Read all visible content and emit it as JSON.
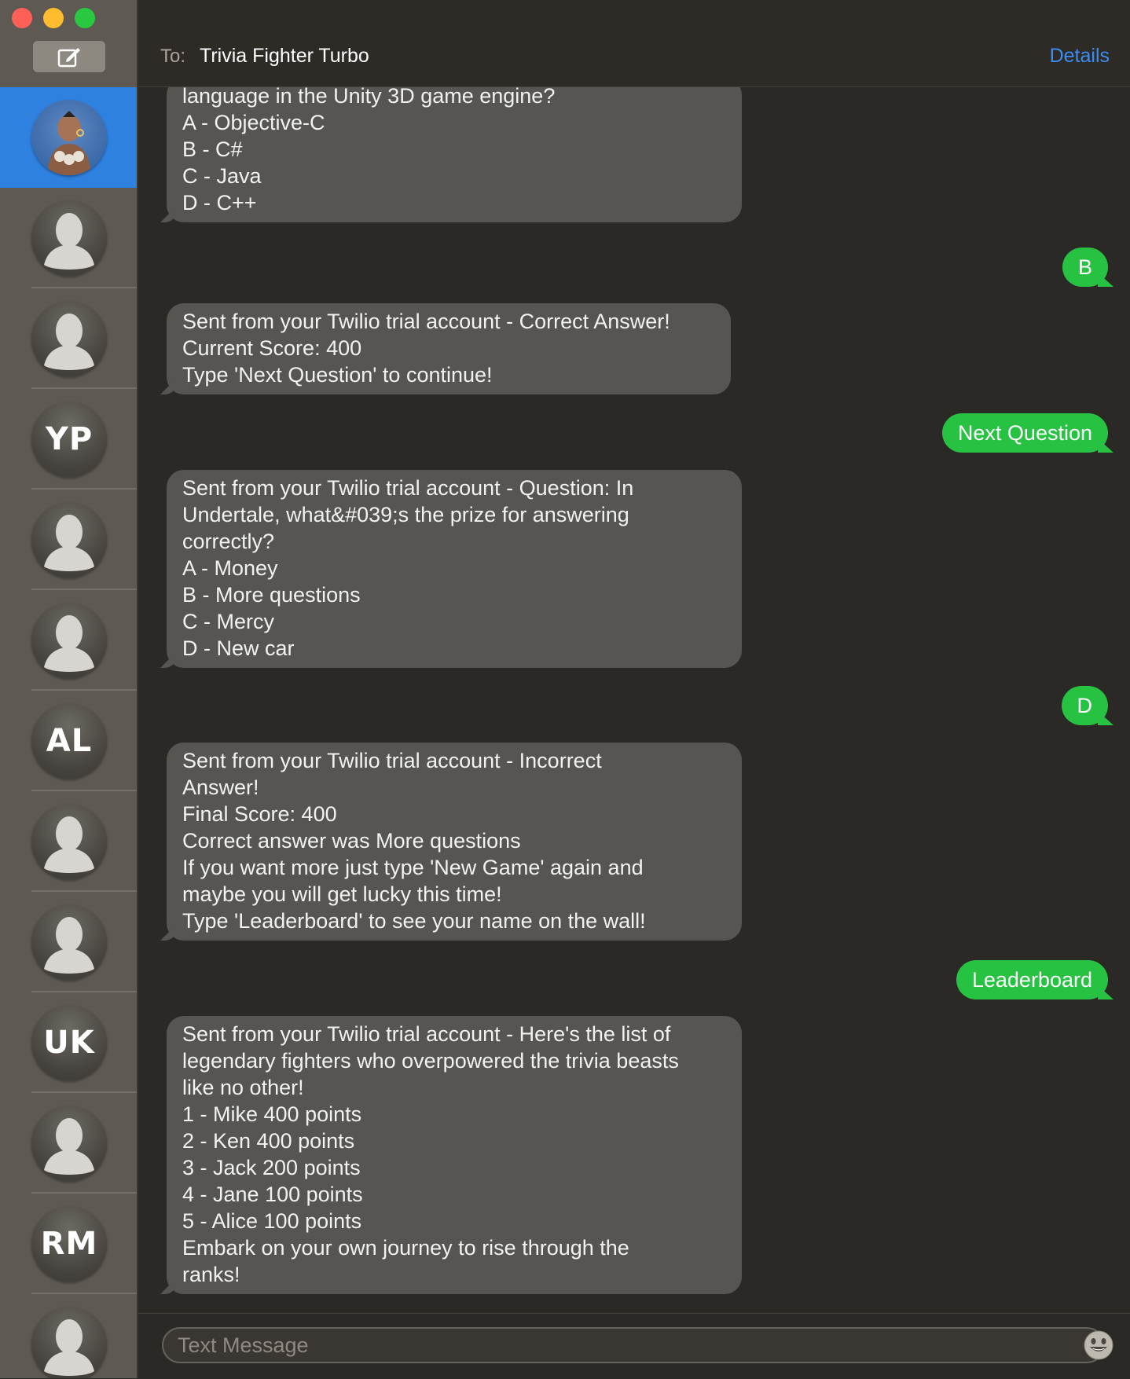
{
  "header": {
    "to_label": "To:",
    "recipient": "Trivia Fighter Turbo",
    "details_label": "Details"
  },
  "sidebar": {
    "contacts": [
      {
        "type": "photo",
        "initials": ""
      },
      {
        "type": "silhouette",
        "initials": ""
      },
      {
        "type": "silhouette",
        "initials": ""
      },
      {
        "type": "initials",
        "initials": "YP"
      },
      {
        "type": "silhouette",
        "initials": ""
      },
      {
        "type": "silhouette",
        "initials": ""
      },
      {
        "type": "initials",
        "initials": "AL"
      },
      {
        "type": "silhouette",
        "initials": ""
      },
      {
        "type": "silhouette",
        "initials": ""
      },
      {
        "type": "initials",
        "initials": "UK"
      },
      {
        "type": "silhouette",
        "initials": ""
      },
      {
        "type": "initials",
        "initials": "RM"
      },
      {
        "type": "silhouette",
        "initials": ""
      }
    ]
  },
  "messages": [
    {
      "dir": "in",
      "text": "language in the Unity 3D game engine?\nA - Objective-C\nB - C#\nC - Java\nD - C++"
    },
    {
      "dir": "out",
      "text": "B"
    },
    {
      "dir": "in",
      "text": "Sent from your Twilio trial account - Correct Answer!\nCurrent Score: 400\nType 'Next Question' to continue!"
    },
    {
      "dir": "out",
      "text": "Next Question"
    },
    {
      "dir": "in",
      "text": "Sent from your Twilio trial account - Question: In\nUndertale, what&#039;s the prize for answering\ncorrectly?\nA - Money\nB - More questions\nC - Mercy\nD - New car"
    },
    {
      "dir": "out",
      "text": "D"
    },
    {
      "dir": "in",
      "text": "Sent from your Twilio trial account - Incorrect\nAnswer!\nFinal Score: 400\nCorrect answer was More questions\nIf you want more just type 'New Game' again and\nmaybe you will get lucky this time!\nType 'Leaderboard' to see your name on the wall!"
    },
    {
      "dir": "out",
      "text": "Leaderboard"
    },
    {
      "dir": "in",
      "text": "Sent from your Twilio trial account - Here's the list of\nlegendary fighters who overpowered the trivia beasts\nlike no other!\n1 - Mike 400 points\n2 - Ken 400 points\n3 - Jack 200 points\n4 - Jane 100 points\n5 - Alice 100 points\nEmbark on your own journey to rise through the\nranks!"
    }
  ],
  "input": {
    "placeholder": "Text Message"
  },
  "colors": {
    "accent": "#2f81e0",
    "sent_bubble": "#28c243",
    "received_bubble": "#575551",
    "link": "#3a8df3"
  },
  "icons": [
    "compose-icon",
    "emoji-icon",
    "contact-silhouette-icon"
  ]
}
